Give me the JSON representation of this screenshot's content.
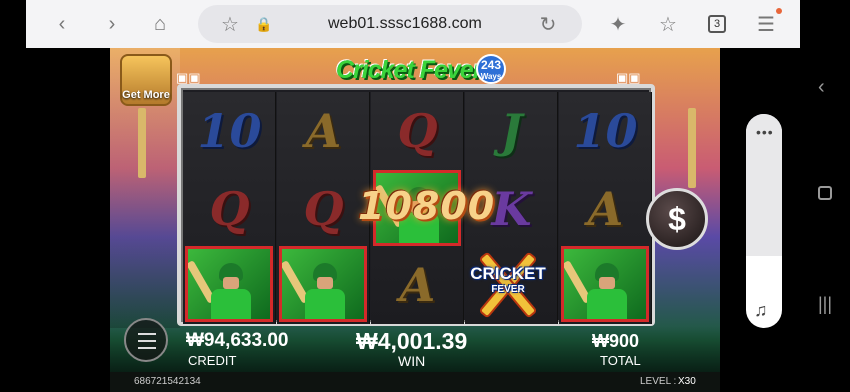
{
  "browser": {
    "url": "web01.sssc1688.com",
    "tab_count": "3",
    "icons": [
      "back-icon",
      "forward-icon",
      "home-icon",
      "bookmark-star-icon",
      "lock-icon",
      "reload-icon",
      "sparkle-icon",
      "star-plus-icon",
      "tabs-icon",
      "menu-icon"
    ]
  },
  "game": {
    "get_more_label": "Get More",
    "logo_text": "Cricket Fever",
    "ways_number": "243",
    "ways_label": "Ways",
    "reels": [
      [
        "10",
        "Q",
        "player"
      ],
      [
        "A",
        "Q",
        "player"
      ],
      [
        "Q",
        "player",
        "A"
      ],
      [
        "J",
        "K",
        "wild"
      ],
      [
        "10",
        "A",
        "player"
      ]
    ],
    "win_amount_display": "10800",
    "wild_text": "CRICKET",
    "wild_sub": "FEVER",
    "coin_symbol": "$",
    "credit_value": "₩94,633.00",
    "credit_label": "CREDIT",
    "win_value": "₩4,001.39",
    "win_label": "WIN",
    "total_value": "₩900",
    "total_label": "TOTAL",
    "session_id": "686721542134",
    "level_label": "LEVEL :",
    "level_value": "X30"
  },
  "colors": {
    "win_highlight": "#d42a2a",
    "accent_green": "#3bd43b",
    "win_text": "#f7d28a"
  }
}
